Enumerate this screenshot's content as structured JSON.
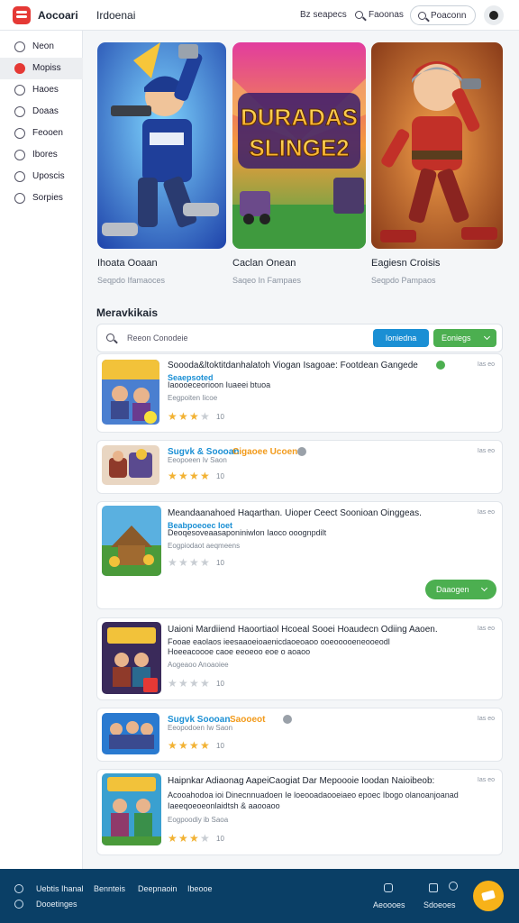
{
  "topbar": {
    "app_name": "Aocoari",
    "page_title": "Irdoenai",
    "link1": "Bz seapecs",
    "link2": "Faoonas",
    "search_label": "Poaconn"
  },
  "sidebar": {
    "items": [
      {
        "label": "Neon",
        "icon": "home-icon"
      },
      {
        "label": "Mopiss",
        "icon": "game-icon"
      },
      {
        "label": "Haoes",
        "icon": "calendar-icon"
      },
      {
        "label": "Doaas",
        "icon": "user-icon"
      },
      {
        "label": "Feooen",
        "icon": "users-icon"
      },
      {
        "label": "Ibores",
        "icon": "people-icon"
      },
      {
        "label": "Uposcis",
        "icon": "target-icon"
      },
      {
        "label": "Sorpies",
        "icon": "settings-icon"
      }
    ]
  },
  "hero": {
    "art_text": "DURADAS SLINGE2",
    "cards": [
      {
        "title": "Ihoata Ooaan",
        "subtitle": "Seqpdo Ifamaoces"
      },
      {
        "title": "Caclan Onean",
        "subtitle": "Saqeo In Fampaes"
      },
      {
        "title": "Eagiesn Croisis",
        "subtitle": "Seqpdo Pampaos"
      }
    ]
  },
  "section": {
    "title": "Meravkikais",
    "search_placeholder": "Reeon Conodeie",
    "btn_blue": "Ioniedna",
    "btn_green": "Eoniegs"
  },
  "rows": [
    {
      "title": "Soooda&ltoktitdanhalatoh Viogan Isagoae: Footdean Gangede",
      "tag": "Seaepsoted",
      "desc": "Iaoooeceorioon Iuaeei btuoa",
      "meta": "Eegpoiten Iicoe",
      "rating": "10",
      "stars": 3,
      "time": "Ias eo",
      "dot_color": "#4caf50"
    },
    {
      "title": "Sugvk & Soooan",
      "title_extra": "Cigaoee Ucoen",
      "meta": "Eeopoeen Iv Saon",
      "rating": "10",
      "stars": 4,
      "time": "Ias eo",
      "dot_color": "#9aa1a9"
    },
    {
      "title": "Meandaanahoed Haqarthan. Uioper Ceect Soonioan Oinggeas.",
      "tag": "Beabpoeoec Ioet",
      "desc": "Deoqesoveaasaponiniwlon Iaoco ooognpdilt",
      "meta": "Eogpiodaot aeqmeens",
      "rating": "10",
      "stars": 0,
      "time": "Ias eo",
      "floating_btn": "Daaogen"
    },
    {
      "title": "Uaioni Mardiiend Haoortiaol Hcoeal Sooei Hoaudecn Odiing Aaoen.",
      "desc": "Fooae eaolaos ieesaaoeioaenicdaoeoaoo ooeooooeneooeodl",
      "desc2": "Hoeeacoooe caoe eeoeoo eoe o aoaoo",
      "meta": "Aogeaoo Anoaoiee",
      "rating": "10",
      "stars": 0,
      "time": "Ias eo"
    },
    {
      "title": "Sugvk Soooan",
      "title_extra": "Saooeot",
      "meta": "Eeopodoen Iw Saon",
      "rating": "10",
      "stars": 4,
      "time": "Ias eo",
      "dot_color": "#9aa1a9"
    },
    {
      "title": "Haipnkar Adiaonag AapeiCaogiat Dar Mepoooie Ioodan Naioibeob:",
      "desc": "Acooahodoa ioi Dinecnnuadoen Ie loeooadaooeiaeo epoec Ibogo olanoanjoanad",
      "desc2": "Iaeeqoeoeonlaidtsh & aaooaoo",
      "meta": "Eogpoodiy ib Saoa",
      "rating": "10",
      "stars": 3,
      "time": "Ias eo"
    }
  ],
  "footer": {
    "items": [
      "Uebtis Ihanal",
      "Bennteis",
      "Deepnaoin",
      "Ibeooe"
    ],
    "line2": "Dooetinges",
    "right1": "Aeoooes",
    "right2": "Sdoeoes"
  }
}
